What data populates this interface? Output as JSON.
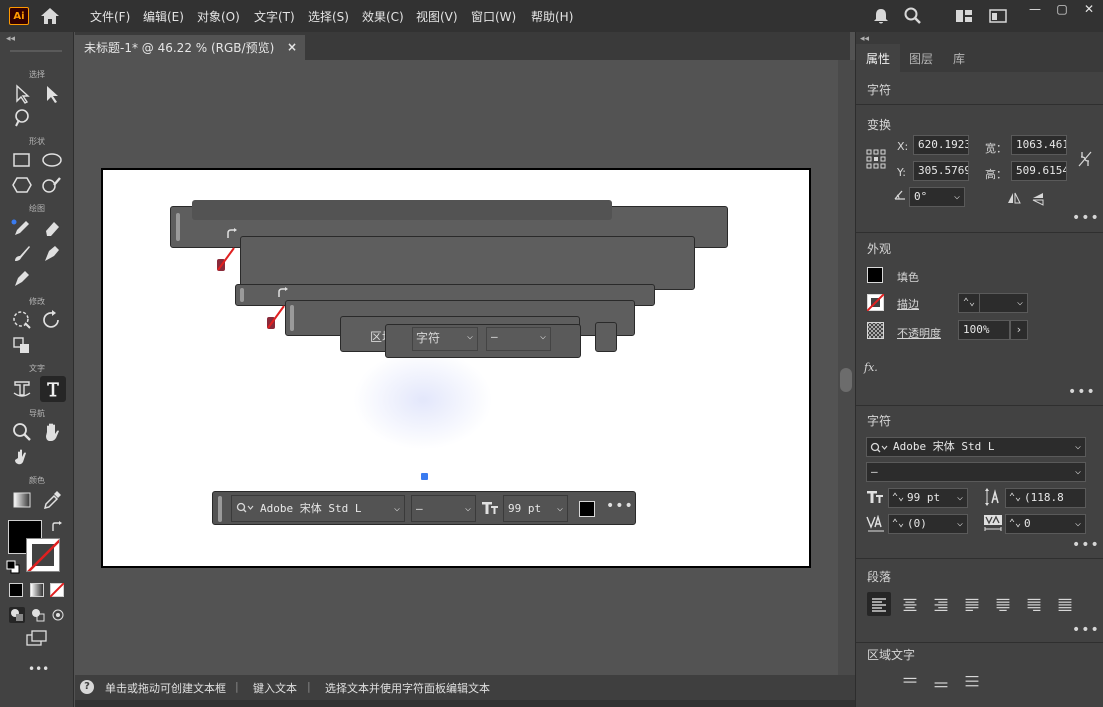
{
  "app": {
    "logo": "Ai",
    "menus": [
      "文件(F)",
      "编辑(E)",
      "对象(O)",
      "文字(T)",
      "选择(S)",
      "效果(C)",
      "视图(V)",
      "窗口(W)",
      "帮助(H)"
    ]
  },
  "toolbar": {
    "groups": [
      "选择",
      "形状",
      "绘图",
      "修改",
      "文字",
      "导航",
      "颜色"
    ],
    "more": "•••"
  },
  "document": {
    "tab_title": "未标题-1* @ 46.22 % (RGB/预览)",
    "close": "×"
  },
  "canvas_overlay": {
    "area_text_label": "区域文",
    "char_label": "字符",
    "dash_value": "–"
  },
  "taskbar": {
    "font_name": "Adobe 宋体 Std L",
    "font_style": "–",
    "font_size": "99 pt",
    "more": "•••"
  },
  "statusbar": {
    "help": "?",
    "hint1": "单击或拖动可创建文本框",
    "hint2": "键入文本",
    "hint3": "选择文本并使用字符面板编辑文本"
  },
  "panel": {
    "tabs": [
      "属性",
      "图层",
      "库"
    ],
    "header": "字符",
    "transform": {
      "title": "变换",
      "x_label": "X:",
      "x": "620.1923",
      "y_label": "Y:",
      "y": "305.5769",
      "w_label": "宽：",
      "w": "1063.461",
      "h_label": "高：",
      "h": "509.6154",
      "angle": "0°"
    },
    "appearance": {
      "title": "外观",
      "fill": "填色",
      "stroke": "描边",
      "opacity": "不透明度",
      "opacity_value": "100%",
      "fx": "fx."
    },
    "character": {
      "title": "字符",
      "font": "Adobe 宋体 Std L",
      "style": "–",
      "size": "99 pt",
      "leading": "(118.8",
      "kerning": "(0)",
      "tracking": "0"
    },
    "paragraph": {
      "title": "段落"
    },
    "area_type": {
      "title": "区域文字"
    }
  },
  "colors": {
    "accent_fill": "#000000",
    "stroke_none": "#e02020",
    "selection_blue": "#3a7bf0"
  }
}
